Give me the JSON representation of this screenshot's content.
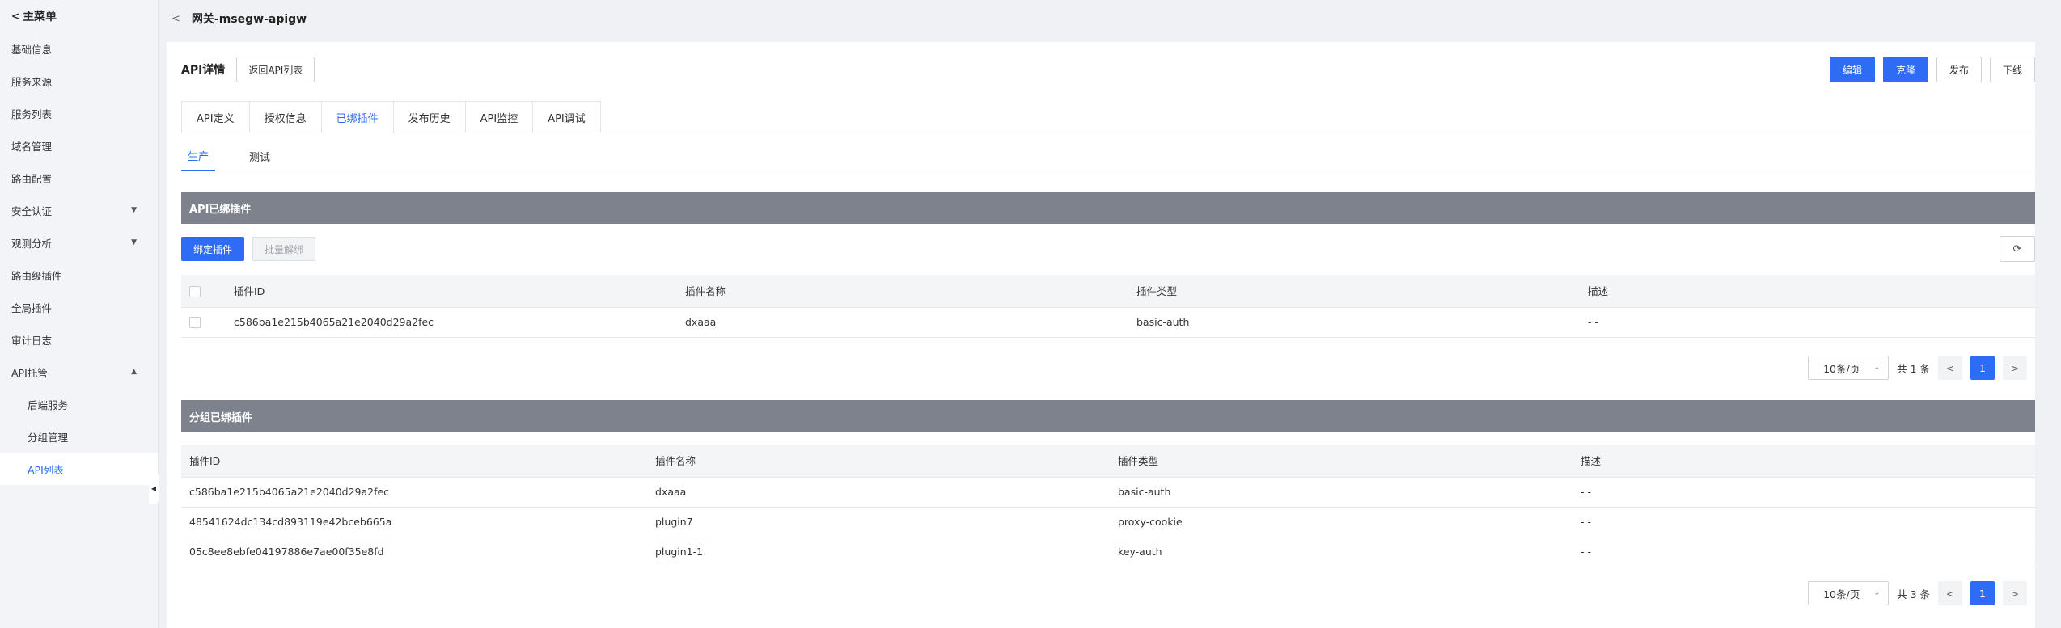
{
  "sidebar": {
    "title": "主菜单",
    "items": [
      {
        "label": "基础信息"
      },
      {
        "label": "服务来源"
      },
      {
        "label": "服务列表"
      },
      {
        "label": "域名管理"
      },
      {
        "label": "路由配置"
      },
      {
        "label": "安全认证"
      },
      {
        "label": "观测分析"
      },
      {
        "label": "路由级插件"
      },
      {
        "label": "全局插件"
      },
      {
        "label": "审计日志"
      },
      {
        "label": "API托管"
      },
      {
        "label": "后端服务"
      },
      {
        "label": "分组管理"
      },
      {
        "label": "API列表"
      }
    ]
  },
  "topbar": {
    "title": "网关-msegw-apigw"
  },
  "header": {
    "page_title": "API详情",
    "back_button": "返回API列表",
    "actions": {
      "edit": "编辑",
      "clone": "克隆",
      "publish": "发布",
      "offline": "下线"
    }
  },
  "tabs": [
    "API定义",
    "授权信息",
    "已绑插件",
    "发布历史",
    "API监控",
    "API调试"
  ],
  "subtabs": [
    "生产",
    "测试"
  ],
  "api_plugins": {
    "section_title": "API已绑插件",
    "bind_button": "绑定插件",
    "batch_unbind_button": "批量解绑",
    "columns": [
      "插件ID",
      "插件名称",
      "插件类型",
      "描述"
    ],
    "rows": [
      [
        "c586ba1e215b4065a21e2040d29a2fec",
        "dxaaa",
        "basic-auth",
        "- -"
      ]
    ],
    "pager": {
      "size": "10条/页",
      "total": "共 1 条",
      "page": "1"
    }
  },
  "group_plugins": {
    "section_title": "分组已绑插件",
    "columns": [
      "插件ID",
      "插件名称",
      "插件类型",
      "描述"
    ],
    "rows": [
      [
        "c586ba1e215b4065a21e2040d29a2fec",
        "dxaaa",
        "basic-auth",
        "- -"
      ],
      [
        "48541624dc134cd893119e42bceb665a",
        "plugin7",
        "proxy-cookie",
        "- -"
      ],
      [
        "05c8ee8ebfe04197886e7ae00f35e8fd",
        "plugin1-1",
        "key-auth",
        "- -"
      ]
    ],
    "pager": {
      "size": "10条/页",
      "total": "共 3 条",
      "page": "1"
    }
  },
  "colors": {
    "accent": "#2f6cf6",
    "section_bar": "#7d828d"
  }
}
